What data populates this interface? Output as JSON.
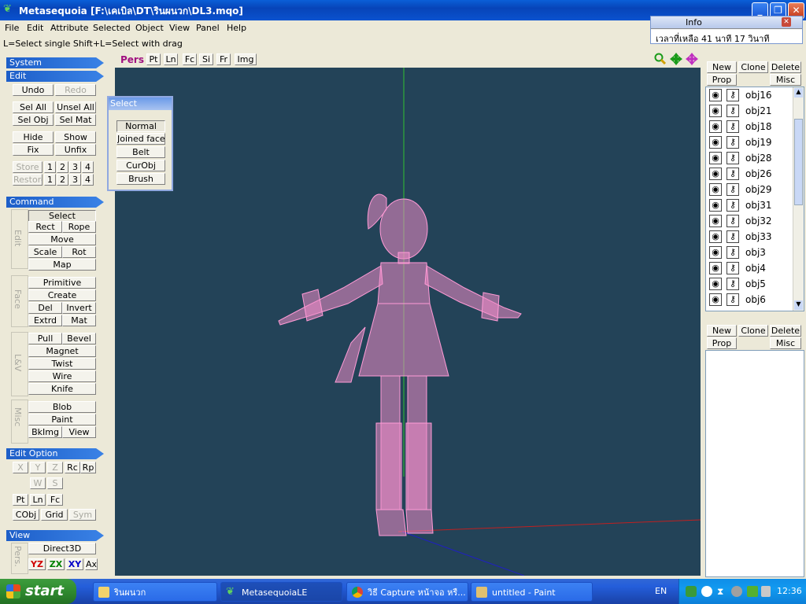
{
  "window": {
    "title": "Metasequoia [F:\\เคเบิล\\DT\\รินผนวก\\DL3.mqo]",
    "minimize": "_",
    "maximize": "❐",
    "close": "✕"
  },
  "menu": [
    "File",
    "Edit",
    "Attribute",
    "Selected",
    "Object",
    "View",
    "Panel",
    "Help"
  ],
  "hint": "L=Select single  Shift+L=Select with drag",
  "info_window": {
    "title": "Info",
    "text": "เวลาที่เหลือ 41 นาที 17 วินาที"
  },
  "left_panel": {
    "system_title": "System",
    "edit_title": "Edit",
    "edit": {
      "undo": "Undo",
      "redo": "Redo",
      "sel_all": "Sel All",
      "unsel_all": "Unsel All",
      "sel_obj": "Sel Obj",
      "sel_mat": "Sel Mat",
      "hide": "Hide",
      "show": "Show",
      "fix": "Fix",
      "unfix": "Unfix",
      "store": "Store",
      "restore": "Restore",
      "slots": [
        "1",
        "2",
        "3",
        "4"
      ]
    },
    "command_title": "Command",
    "command": {
      "edit_label": "Edit",
      "select": "Select",
      "rect": "Rect",
      "rope": "Rope",
      "move": "Move",
      "scale": "Scale",
      "rot": "Rot",
      "map": "Map",
      "face_label": "Face",
      "primitive": "Primitive",
      "create": "Create",
      "del": "Del",
      "invert": "Invert",
      "extrd": "Extrd",
      "mat": "Mat",
      "lv_label": "L&V",
      "pull": "Pull",
      "bevel": "Bevel",
      "magnet": "Magnet",
      "twist": "Twist",
      "wire": "Wire",
      "knife": "Knife",
      "misc_label": "Misc",
      "blob": "Blob",
      "paint": "Paint",
      "bkimg": "BkImg",
      "view": "View"
    },
    "edit_option_title": "Edit Option",
    "edit_option": {
      "x": "X",
      "y": "Y",
      "z": "Z",
      "rc": "Rc",
      "rp": "Rp",
      "w": "W",
      "s": "S",
      "pt": "Pt",
      "ln": "Ln",
      "fc": "Fc",
      "cobj": "CObj",
      "grid": "Grid",
      "sym": "Sym"
    },
    "view_title": "View",
    "view": {
      "pers_label": "Pers.",
      "direct3d": "Direct3D",
      "yz": "YZ",
      "zx": "ZX",
      "xy": "XY",
      "ax": "Ax"
    }
  },
  "select_popup": {
    "title": "Select",
    "items": [
      "Normal",
      "Joined face",
      "Belt",
      "CurObj",
      "Brush"
    ]
  },
  "viewport_toolbar": {
    "pers": "Pers",
    "pt": "Pt",
    "ln": "Ln",
    "fc": "Fc",
    "si": "Si",
    "fr": "Fr",
    "img": "Img",
    "zoom_icon": "magnifier-icon",
    "pan_icon": "move-arrows-icon",
    "rotate_icon": "rotate-arrows-icon"
  },
  "object_panel": {
    "new": "New",
    "clone": "Clone",
    "delete": "Delete",
    "prop": "Prop",
    "misc": "Misc",
    "objects": [
      "obj16",
      "obj21",
      "obj18",
      "obj19",
      "obj28",
      "obj26",
      "obj29",
      "obj31",
      "obj32",
      "obj33",
      "obj3",
      "obj4",
      "obj5",
      "obj6"
    ]
  },
  "material_panel": {
    "new": "New",
    "clone": "Clone",
    "delete": "Delete",
    "prop": "Prop",
    "misc": "Misc"
  },
  "taskbar": {
    "start": "start",
    "tasks": [
      "รินผนวก",
      "MetasequoiaLE",
      "วิธี Capture หน้าจอ หรื...",
      "untitled - Paint"
    ],
    "lang": "EN",
    "clock": "12:36"
  },
  "colors": {
    "viewport_bg": "#234358",
    "mesh": "#f08cc8",
    "xp_blue": "#245edb",
    "panel_header": "#1d5ec8"
  }
}
